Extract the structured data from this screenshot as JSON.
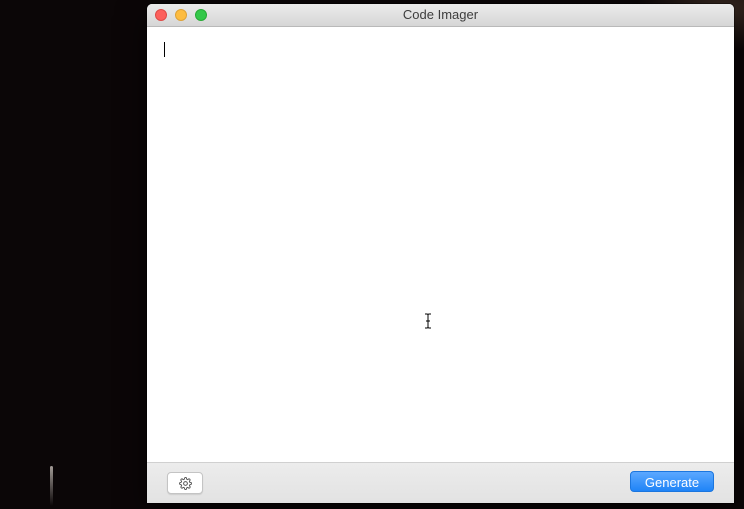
{
  "window": {
    "title": "Code Imager"
  },
  "editor": {
    "content": ""
  },
  "toolbar": {
    "settings_icon": "gear-icon",
    "generate_label": "Generate"
  },
  "colors": {
    "accent": "#1f84f7",
    "close": "#fc605c",
    "minimize": "#fdbc40",
    "zoom": "#34c84a"
  }
}
